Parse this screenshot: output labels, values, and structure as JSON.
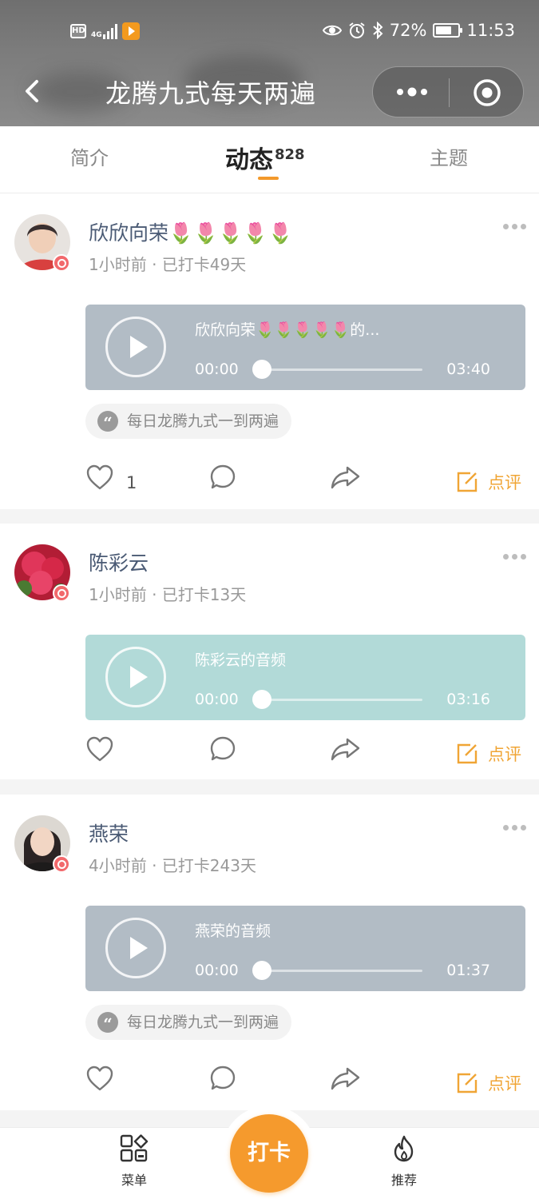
{
  "status_bar": {
    "hd_label": "HD",
    "network": "4G",
    "battery_percent": "72%",
    "time": "11:53",
    "battery_level": 0.72
  },
  "nav": {
    "title": "龙腾九式每天两遍"
  },
  "tabs": [
    {
      "label": "简介"
    },
    {
      "label": "动态",
      "count": "828"
    },
    {
      "label": "主题"
    }
  ],
  "posts": [
    {
      "user": "欣欣向荣🌷🌷🌷🌷🌷",
      "meta": "1小时前 · 已打卡49天",
      "audio_title": "欣欣向荣🌷🌷🌷🌷🌷的...",
      "time_start": "00:00",
      "time_end": "03:40",
      "topic": "每日龙腾九式一到两遍",
      "likes": "1",
      "review_label": "点评"
    },
    {
      "user": "陈彩云",
      "meta": "1小时前 · 已打卡13天",
      "audio_title": "陈彩云的音频",
      "time_start": "00:00",
      "time_end": "03:16",
      "review_label": "点评"
    },
    {
      "user": "燕荣",
      "meta": "4小时前 · 已打卡243天",
      "audio_title": "燕荣的音频",
      "time_start": "00:00",
      "time_end": "01:37",
      "topic": "每日龙腾九式一到两遍",
      "review_label": "点评"
    }
  ],
  "bottom_bar": {
    "menu_label": "菜单",
    "checkin_label": "打卡",
    "recommend_label": "推荐"
  },
  "colors": {
    "accent_orange": "#f59a2d",
    "review_orange": "#f0a535",
    "audio_grey": "#b2bcc5",
    "audio_teal": "#b2dad8",
    "username_blue": "#4a5a74"
  }
}
